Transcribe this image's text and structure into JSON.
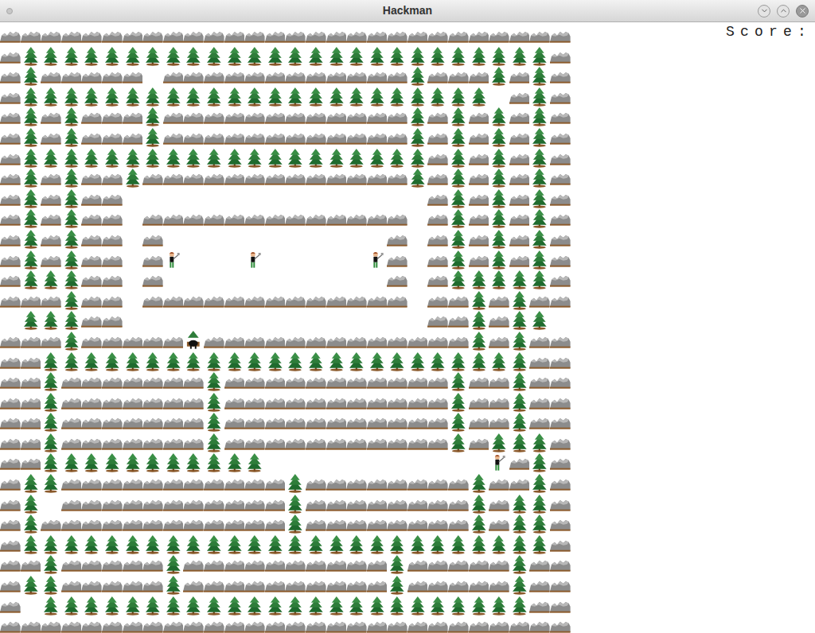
{
  "window": {
    "title": "Hackman"
  },
  "score": {
    "label": "Score:"
  },
  "board": {
    "rows": [
      "############################",
      "#TTTTTTTTTTTTTTTTTTTTTTTTTT#",
      "#T#####.############T###T#T#",
      "#TTTTTTTTTTTTTTTTTTTTTTT.#T#",
      "#T#T###T############T#T#T#T#",
      "#T#T###T############T#T#T#T#",
      "#TTTTTTTTTTTTTTTTTTTT#T#T#T#",
      "#T#T##T#############T#T#T#T#",
      "#T#T##...............#T#T#T#",
      "#T#T##.#############.#T#T#T#",
      "#T#T##.#...........#.#T#T#T#",
      "#T#T##.#L...L.....L#.#T#T#T#",
      "#TTT##.#...........#.#TTTTT#",
      "###T##.#############.##T#T##",
      ".TTT##...............##T#TT.",
      "###T#####P#############T#T##",
      "##TTTTTTTTTTTTTTTTTTTTTTTT##",
      "##T#######T###########T##T##",
      "##T#######T###########T##T##",
      "##T#######T###########T##T##",
      "##T#######T###########T#TTT#",
      "##TTTTTTTTTTT...........L#T#",
      "#TT###########T########T##T#",
      "#T.###########T########T#TT#",
      "#T############T########T#TT#",
      "#TTTTTTTTTTTTTTTTTTTTTTTTTT#",
      "##T#####T##########T#####T##",
      "#TT#####T##########T#####T##",
      "#.TTTTTTTTTTTTTTTTTTTTTTTT##",
      "############################"
    ]
  }
}
